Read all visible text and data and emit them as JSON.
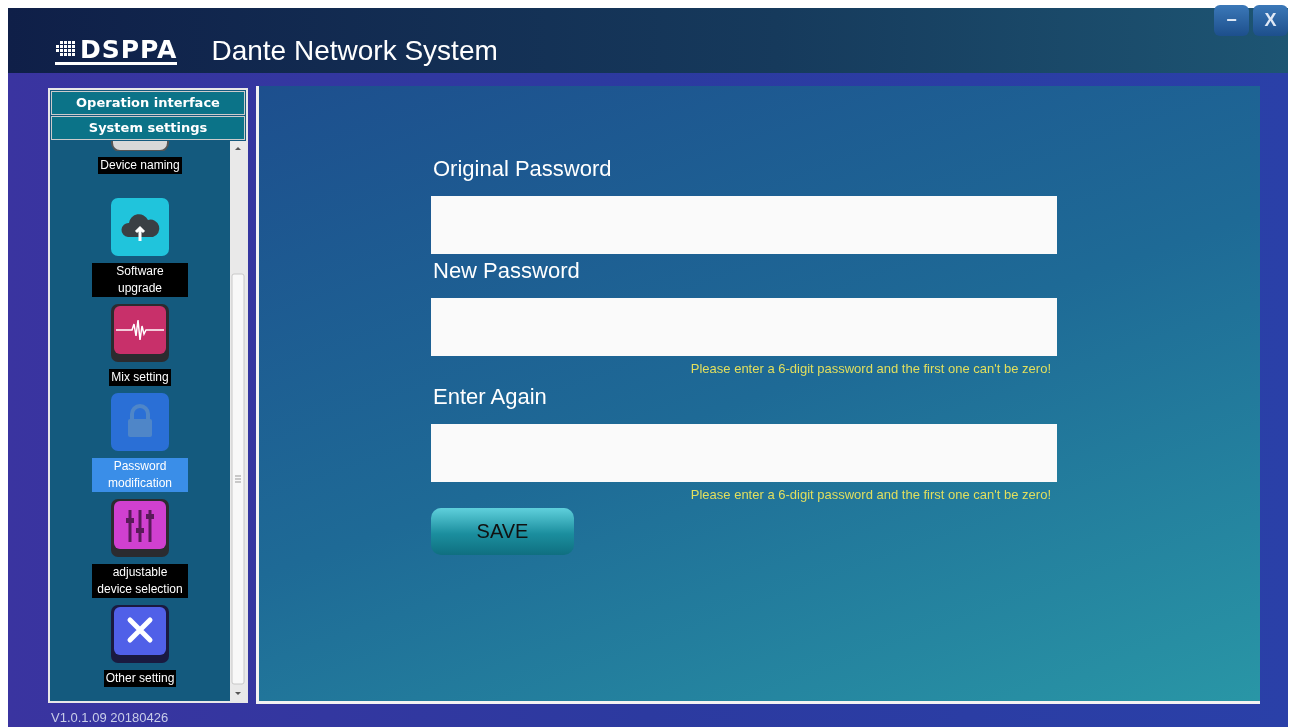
{
  "window": {
    "logo": "DSPPA",
    "title": "Dante Network System",
    "controls": [
      "−",
      "X"
    ]
  },
  "sidebar": {
    "tabs": [
      {
        "label": "Operation interface"
      },
      {
        "label": "System settings"
      }
    ],
    "items": [
      {
        "label": "Device naming",
        "kind": "naming",
        "selected": false
      },
      {
        "label": "Software upgrade",
        "kind": "upgrade",
        "selected": false
      },
      {
        "label": "Mix setting",
        "kind": "mix",
        "selected": false
      },
      {
        "label": "Password modification",
        "kind": "password",
        "selected": true
      },
      {
        "label": "adjustable device selection",
        "kind": "mixer",
        "selected": false
      },
      {
        "label": "Other setting",
        "kind": "tools",
        "selected": false
      }
    ]
  },
  "form": {
    "fields": [
      {
        "label": "Original Password"
      },
      {
        "label": "New Password",
        "hint": "Please enter a 6-digit password and the first one can't be zero!"
      },
      {
        "label": "Enter Again",
        "hint": "Please enter a 6-digit password and the first one can't be zero!"
      }
    ],
    "save_button": "SAVE"
  },
  "status_bar": {
    "version": "V1.0.1.09  20180426"
  }
}
